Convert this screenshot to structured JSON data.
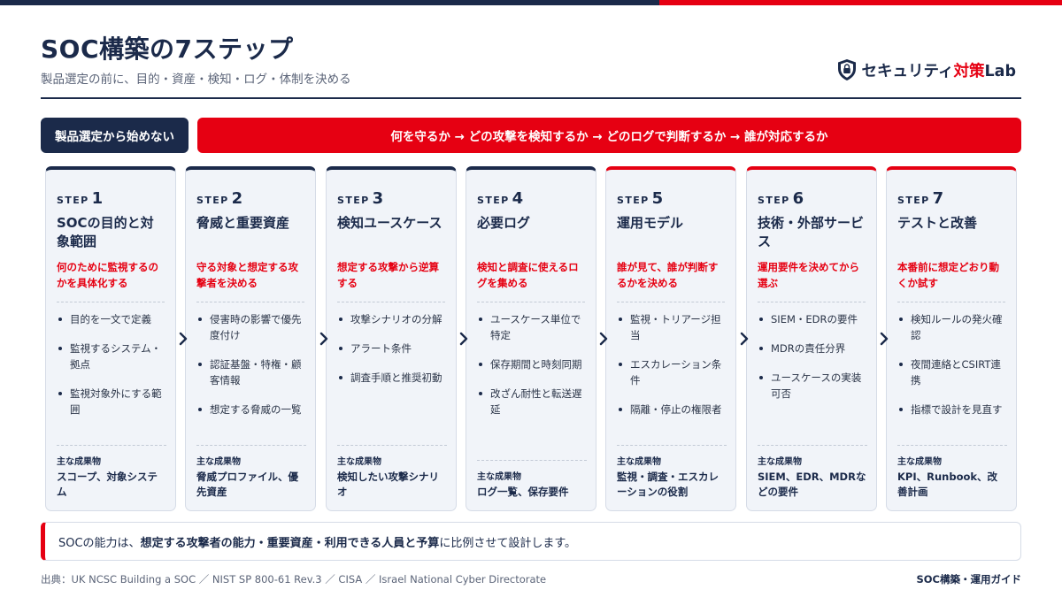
{
  "header": {
    "title": "SOC構築の7ステップ",
    "subtitle": "製品選定の前に、目的・資産・検知・ログ・体制を決める",
    "brand_prefix": "セキュリティ",
    "brand_highlight": "対策",
    "brand_suffix": "Lab",
    "brand_icon": "shield-lock-icon"
  },
  "banner": {
    "left": "製品選定から始めない",
    "right": "何を守るか → どの攻撃を検知するか → どのログで判断するか → 誰が対応するか"
  },
  "steps": [
    {
      "label": "STEP",
      "num": "1",
      "title": "SOCの目的と対象範囲",
      "desc": "何のために監視するのかを具体化する",
      "bullets": [
        "目的を一文で定義",
        "監視するシステム・拠点",
        "監視対象外にする範囲"
      ],
      "output_label": "主な成果物",
      "output": "スコープ、対象システム"
    },
    {
      "label": "STEP",
      "num": "2",
      "title": "脅威と重要資産",
      "desc": "守る対象と想定する攻撃者を決める",
      "bullets": [
        "侵害時の影響で優先度付け",
        "認証基盤・特権・顧客情報",
        "想定する脅威の一覧"
      ],
      "output_label": "主な成果物",
      "output": "脅威プロファイル、優先資産"
    },
    {
      "label": "STEP",
      "num": "3",
      "title": "検知ユースケース",
      "desc": "想定する攻撃から逆算する",
      "bullets": [
        "攻撃シナリオの分解",
        "アラート条件",
        "調査手順と推奨初動"
      ],
      "output_label": "主な成果物",
      "output": "検知したい攻撃シナリオ"
    },
    {
      "label": "STEP",
      "num": "4",
      "title": "必要ログ",
      "desc": "検知と調査に使えるログを集める",
      "bullets": [
        "ユースケース単位で特定",
        "保存期間と時刻同期",
        "改ざん耐性と転送遅延"
      ],
      "output_label": "主な成果物",
      "output": "ログ一覧、保存要件"
    },
    {
      "label": "STEP",
      "num": "5",
      "title": "運用モデル",
      "desc": "誰が見て、誰が判断するかを決める",
      "bullets": [
        "監視・トリアージ担当",
        "エスカレーション条件",
        "隔離・停止の権限者"
      ],
      "output_label": "主な成果物",
      "output": "監視・調査・エスカレーションの役割"
    },
    {
      "label": "STEP",
      "num": "6",
      "title": "技術・外部サービス",
      "desc": "運用要件を決めてから選ぶ",
      "bullets": [
        "SIEM・EDRの要件",
        "MDRの責任分界",
        "ユースケースの実装可否"
      ],
      "output_label": "主な成果物",
      "output": "SIEM、EDR、MDRなどの要件"
    },
    {
      "label": "STEP",
      "num": "7",
      "title": "テストと改善",
      "desc": "本番前に想定どおり動くか試す",
      "bullets": [
        "検知ルールの発火確認",
        "夜間連絡とCSIRT連携",
        "指標で設計を見直す"
      ],
      "output_label": "主な成果物",
      "output": "KPI、Runbook、改善計画"
    }
  ],
  "note": {
    "prefix": "SOCの能力は、",
    "bold": "想定する攻撃者の能力・重要資産・利用できる人員と予算",
    "suffix": "に比例させて設計します。"
  },
  "footer": {
    "source": "出典：UK NCSC Building a SOC ／ NIST SP 800-61 Rev.3 ／ CISA ／ Israel National Cyber Directorate",
    "guide": "SOC構築・運用ガイド"
  },
  "colors": {
    "navy": "#1b2a4a",
    "red": "#e60012",
    "card_bg": "#f1f4f9"
  }
}
